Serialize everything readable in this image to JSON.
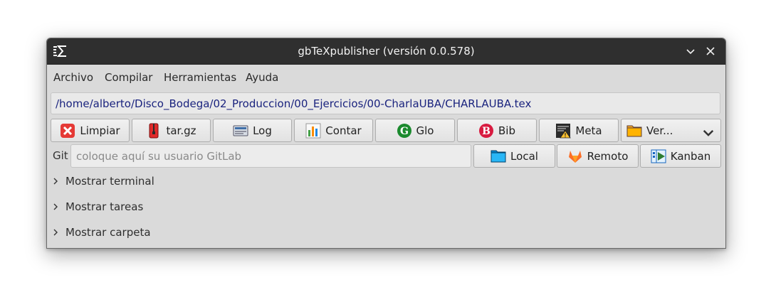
{
  "window": {
    "title": "gbTeXpublisher (versión 0.0.578)"
  },
  "menu": {
    "items": [
      "Archivo",
      "Compilar",
      "Herramientas",
      "Ayuda"
    ]
  },
  "path": {
    "value": "/home/alberto/Disco_Bodega/02_Produccion/00_Ejercicios/00-CharlaUBA/CHARLAUBA.tex"
  },
  "toolbar": {
    "buttons": [
      {
        "label": "Limpiar",
        "icon": "clean-icon"
      },
      {
        "label": "tar.gz",
        "icon": "archive-icon"
      },
      {
        "label": "Log",
        "icon": "log-icon"
      },
      {
        "label": "Contar",
        "icon": "chart-icon"
      },
      {
        "label": "Glo",
        "icon": "glossary-icon"
      },
      {
        "label": "Bib",
        "icon": "bibliography-icon"
      },
      {
        "label": "Meta",
        "icon": "meta-icon"
      },
      {
        "label": "Ver...",
        "icon": "folder-icon"
      }
    ]
  },
  "git": {
    "label": "Git",
    "placeholder": "coloque aquí su usuario GitLab",
    "value": "",
    "buttons": [
      {
        "label": "Local",
        "icon": "folder-icon"
      },
      {
        "label": "Remoto",
        "icon": "gitlab-icon"
      },
      {
        "label": "Kanban",
        "icon": "kanban-icon"
      }
    ]
  },
  "expanders": [
    "Mostrar terminal",
    "Mostrar tareas",
    "Mostrar carpeta"
  ],
  "colors": {
    "titlebar": "#2f2f2f",
    "window_bg": "#dadada",
    "path_text": "#1a237e",
    "glo_green": "#1b8a2e",
    "bib_red": "#d81b40",
    "clean_red": "#e53935"
  }
}
